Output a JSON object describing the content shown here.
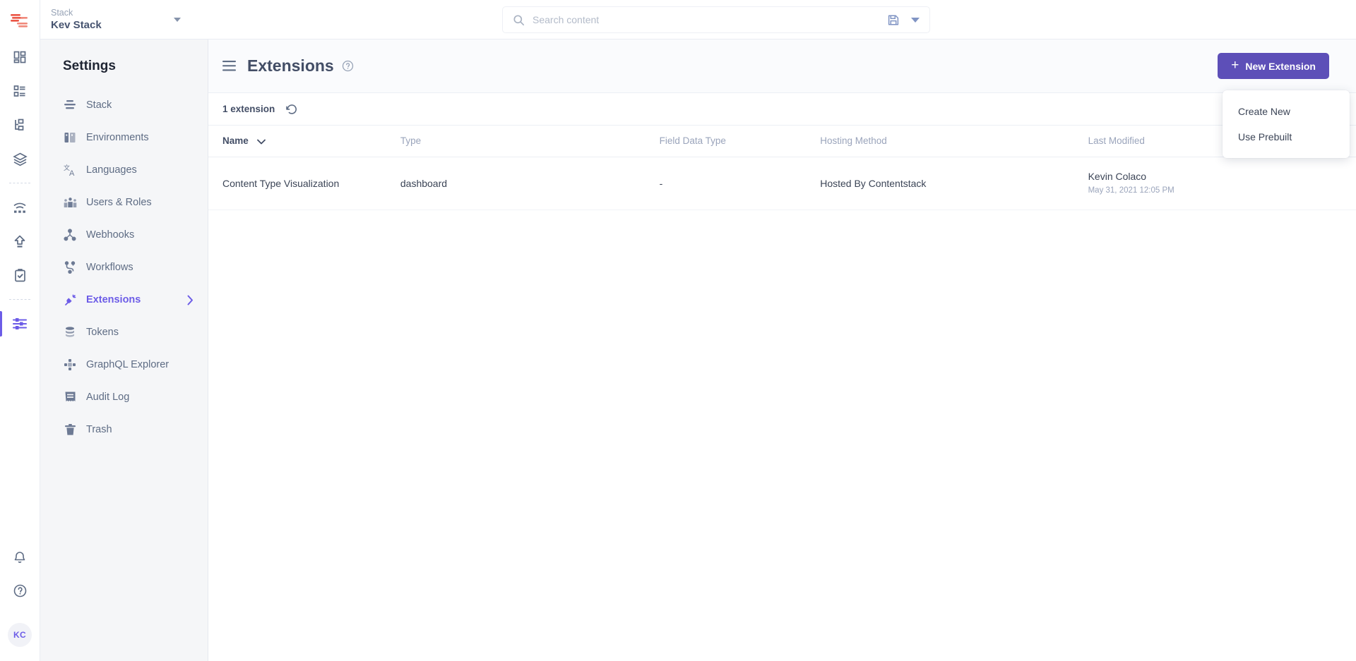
{
  "brand": {
    "logo_name": "contentstack-logo",
    "accent": "#6c5ce7",
    "button_color": "#5d4fb8",
    "logo_color": "#eb5646"
  },
  "topbar": {
    "stack": {
      "label": "Stack",
      "name": "Kev Stack",
      "caret_icon": "caret-down-icon"
    },
    "search": {
      "placeholder": "Search content",
      "value": "",
      "icon": "search-icon",
      "save_icon": "save-icon",
      "chevron_icon": "chevron-down-icon"
    }
  },
  "rail": {
    "items": [
      {
        "name": "dashboard",
        "icon": "dashboard-grid-icon",
        "active": false
      },
      {
        "name": "content-types",
        "icon": "content-list-icon",
        "active": false
      },
      {
        "name": "entries",
        "icon": "hierarchy-icon",
        "active": false
      },
      {
        "name": "assets",
        "icon": "layers-icon",
        "active": false
      },
      {
        "name": "publish-queue",
        "icon": "wifi-signal-icon",
        "active": false
      },
      {
        "name": "releases",
        "icon": "upload-arrow-icon",
        "active": false
      },
      {
        "name": "audit",
        "icon": "clipboard-check-icon",
        "active": false
      },
      {
        "name": "settings",
        "icon": "sliders-icon",
        "active": true
      }
    ],
    "bottom": [
      {
        "name": "notifications",
        "icon": "bell-icon"
      },
      {
        "name": "help",
        "icon": "question-circle-icon"
      }
    ],
    "avatar": {
      "initials": "KC",
      "name": "avatar"
    }
  },
  "settings": {
    "title": "Settings",
    "items": [
      {
        "label": "Stack",
        "icon": "stack-lines-icon",
        "active": false,
        "has_chevron": false
      },
      {
        "label": "Environments",
        "icon": "environments-icon",
        "active": false,
        "has_chevron": false
      },
      {
        "label": "Languages",
        "icon": "languages-icon",
        "active": false,
        "has_chevron": false
      },
      {
        "label": "Users & Roles",
        "icon": "users-icon",
        "active": false,
        "has_chevron": false
      },
      {
        "label": "Webhooks",
        "icon": "webhooks-icon",
        "active": false,
        "has_chevron": false
      },
      {
        "label": "Workflows",
        "icon": "workflows-icon",
        "active": false,
        "has_chevron": false
      },
      {
        "label": "Extensions",
        "icon": "extensions-plug-icon",
        "active": true,
        "has_chevron": true
      },
      {
        "label": "Tokens",
        "icon": "tokens-database-icon",
        "active": false,
        "has_chevron": false
      },
      {
        "label": "GraphQL Explorer",
        "icon": "graphql-icon",
        "active": false,
        "has_chevron": false
      },
      {
        "label": "Audit Log",
        "icon": "audit-log-icon",
        "active": false,
        "has_chevron": false
      },
      {
        "label": "Trash",
        "icon": "trash-icon",
        "active": false,
        "has_chevron": false
      }
    ]
  },
  "main": {
    "hamburger_icon": "hamburger-menu-icon",
    "title": "Extensions",
    "help_icon": "help-circle-icon",
    "new_button": {
      "label": "New Extension",
      "icon": "plus-icon"
    },
    "toolbar": {
      "count_label": "1 extension",
      "refresh_icon": "refresh-reset-icon"
    },
    "table": {
      "columns": [
        {
          "label": "Name",
          "sortable": true,
          "sort_icon": "chevron-down-icon"
        },
        {
          "label": "Type",
          "sortable": false
        },
        {
          "label": "Field Data Type",
          "sortable": false
        },
        {
          "label": "Hosting Method",
          "sortable": false
        },
        {
          "label": "Last Modified",
          "sortable": false
        }
      ],
      "rows": [
        {
          "name": "Content Type Visualization",
          "type": "dashboard",
          "field_data_type": "-",
          "hosting_method": "Hosted By Contentstack",
          "modified_by": "Kevin Colaco",
          "modified_at": "May 31, 2021 12:05 PM"
        }
      ]
    }
  },
  "menu": {
    "items": [
      {
        "label": "Create New"
      },
      {
        "label": "Use Prebuilt"
      }
    ]
  }
}
